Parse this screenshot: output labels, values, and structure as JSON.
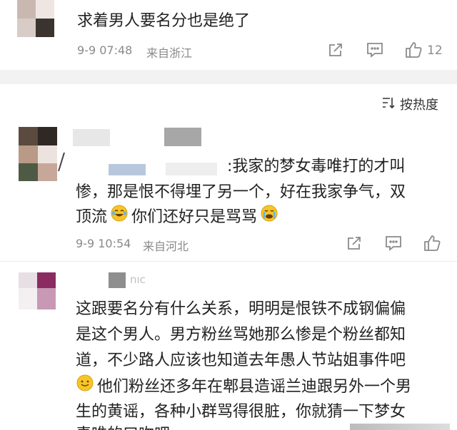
{
  "comment1": {
    "text": "求着男人要名分也是绝了",
    "timestamp": "9-9 07:48",
    "location": "来自浙江",
    "likes": "12"
  },
  "sort": {
    "label": "按热度"
  },
  "comment2": {
    "text_line1": ":我家的梦女毒唯打的才叫",
    "text_line2": "惨，那是恨不得埋了另一个，好在我家争气，双",
    "text_line3a": "顶流",
    "text_line3b": "你们还好只是骂骂",
    "timestamp": "9-9 10:54",
    "location": "来自河北"
  },
  "comment3": {
    "username_partial": "nic",
    "lines": [
      "这跟要名分有什么关系，明明是恨铁不成钢偏偏",
      "是这个男人。男方粉丝骂她那么惨是个粉丝都知",
      "道，不少路人应该也知道去年愚人节站姐事件吧",
      "他们粉丝还多年在郫县造谣兰迪跟另外一个男",
      "生的黄谣，各种小群骂得很脏，你就猜一下梦女",
      "毒唯的口吻吧"
    ]
  }
}
